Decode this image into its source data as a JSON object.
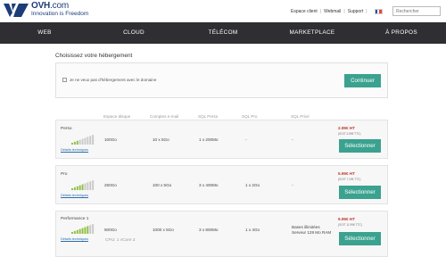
{
  "header": {
    "logo_name": "OVH",
    "logo_suffix": ".com",
    "tagline": "Innovation is Freedom",
    "links": [
      "Espace client",
      "Webmail",
      "Support"
    ],
    "search_placeholder": "Rechercher",
    "flag_colors": [
      "#0055a4",
      "#ffffff",
      "#ef4135"
    ]
  },
  "nav": {
    "items": [
      "WEB",
      "CLOUD",
      "TÉLÉCOM",
      "MARKETPLACE",
      "À PROPOS"
    ]
  },
  "page": {
    "title": "Choisissez votre hébergement",
    "no_hosting_label": "Je ne veux pas d'hébergement avec le domaine",
    "continue_label": "Continuer"
  },
  "columns": [
    "Espace disque",
    "Comptes e-mail",
    "SQL Perso",
    "SQL Pro",
    "SQL Privé"
  ],
  "plans": [
    {
      "name": "Perso",
      "details": "Détails techniques",
      "disk": "100Go",
      "email": "10 x 5Go",
      "sql_perso": "1 x 200Mo",
      "sql_pro": "-",
      "sql_prive": "-",
      "price": "2.99€ HT",
      "price_ttc": "(SOIT 3.59€ TTC)",
      "select": "Sélectionner",
      "level": 0.33
    },
    {
      "name": "Pro",
      "details": "Détails techniques",
      "disk": "250Go",
      "email": "100 x 5Go",
      "sql_perso": "3 x 400Mo",
      "sql_pro": "1 x 2Go",
      "sql_prive": "-",
      "price": "5.99€ HT",
      "price_ttc": "(SOIT 7.19€ TTC)",
      "select": "Sélectionner",
      "level": 0.56
    },
    {
      "name": "Performance 1",
      "details": "Détails techniques",
      "disk": "500Go",
      "email": "1000 x 5Go",
      "sql_perso": "3 x 800Mo",
      "sql_pro": "1 x 4Go",
      "sql_prive": "Bases illimitées\nServeur 128 Mo RAM",
      "price": "9.99€ HT",
      "price_ttc": "(SOIT 11.99€ TTC)",
      "select": "Sélectionner",
      "cpu": "CPU: 1 vCore  2",
      "level": 0.78
    }
  ],
  "colors": {
    "nav_bg": "#2f2f33",
    "accent": "#3aa28f",
    "price": "#c0392b",
    "brand": "#1c3d78"
  }
}
